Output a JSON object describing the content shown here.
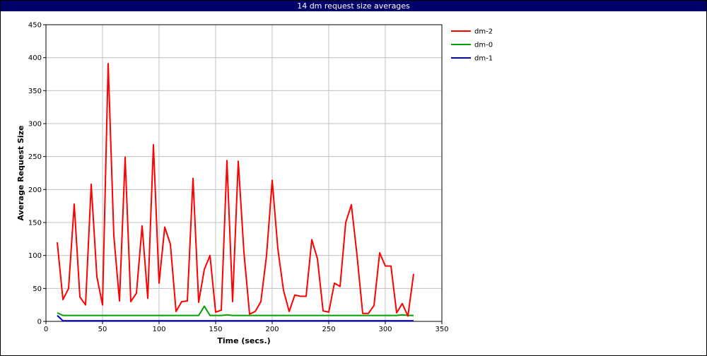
{
  "window": {
    "title": "14 dm request size averages"
  },
  "chart_data": {
    "type": "line",
    "title": "14 dm request size averages",
    "xlabel": "Time (secs.)",
    "ylabel": "Average Request Size",
    "xlim": [
      0,
      350
    ],
    "ylim": [
      0,
      450
    ],
    "xticks": [
      0,
      50,
      100,
      150,
      200,
      250,
      300,
      350
    ],
    "yticks": [
      0,
      50,
      100,
      150,
      200,
      250,
      300,
      350,
      400,
      450
    ],
    "grid": true,
    "legend_position": "right",
    "series": [
      {
        "name": "dm-2",
        "color": "#ff0000",
        "x": [
          10,
          15,
          20,
          25,
          30,
          35,
          40,
          45,
          50,
          55,
          60,
          65,
          70,
          75,
          80,
          85,
          90,
          95,
          100,
          105,
          110,
          115,
          120,
          125,
          130,
          135,
          140,
          145,
          150,
          155,
          160,
          165,
          170,
          175,
          180,
          185,
          190,
          195,
          200,
          205,
          210,
          215,
          220,
          225,
          230,
          235,
          240,
          245,
          250,
          255,
          260,
          265,
          270,
          275,
          280,
          285,
          290,
          295,
          300,
          305,
          310,
          315,
          320,
          325
        ],
        "y": [
          120,
          33,
          50,
          178,
          37,
          25,
          208,
          68,
          25,
          391,
          130,
          31,
          249,
          30,
          43,
          145,
          35,
          268,
          58,
          143,
          117,
          15,
          30,
          31,
          217,
          29,
          79,
          100,
          14,
          17,
          244,
          30,
          243,
          105,
          11,
          15,
          30,
          100,
          214,
          110,
          47,
          15,
          40,
          38,
          38,
          124,
          95,
          16,
          14,
          58,
          53,
          150,
          177,
          100,
          12,
          12,
          24,
          104,
          84,
          84,
          13,
          27,
          8,
          72
        ]
      },
      {
        "name": "dm-0",
        "color": "#00a000",
        "x": [
          10,
          15,
          20,
          25,
          30,
          35,
          40,
          45,
          50,
          55,
          60,
          65,
          70,
          75,
          80,
          85,
          90,
          95,
          100,
          105,
          110,
          115,
          120,
          125,
          130,
          135,
          140,
          145,
          150,
          155,
          160,
          165,
          170,
          175,
          180,
          185,
          190,
          195,
          200,
          205,
          210,
          215,
          220,
          225,
          230,
          235,
          240,
          245,
          250,
          255,
          260,
          265,
          270,
          275,
          280,
          285,
          290,
          295,
          300,
          305,
          310,
          315,
          320,
          325
        ],
        "y": [
          13,
          9,
          9,
          9,
          9,
          9,
          9,
          9,
          9,
          9,
          9,
          9,
          9,
          9,
          9,
          9,
          9,
          9,
          9,
          9,
          9,
          9,
          9,
          9,
          9,
          9,
          23,
          9,
          9,
          9,
          10,
          9,
          9,
          9,
          9,
          9,
          9,
          9,
          9,
          9,
          9,
          9,
          9,
          9,
          9,
          9,
          9,
          9,
          9,
          9,
          9,
          9,
          9,
          9,
          9,
          9,
          9,
          9,
          9,
          9,
          9,
          10,
          9,
          9
        ]
      },
      {
        "name": "dm-1",
        "color": "#0000cc",
        "x": [
          10,
          15,
          20,
          25,
          30,
          35,
          40,
          45,
          50,
          55,
          60,
          65,
          70,
          75,
          80,
          85,
          90,
          95,
          100,
          105,
          110,
          115,
          120,
          125,
          130,
          135,
          140,
          145,
          150,
          155,
          160,
          165,
          170,
          175,
          180,
          185,
          190,
          195,
          200,
          205,
          210,
          215,
          220,
          225,
          230,
          235,
          240,
          245,
          250,
          255,
          260,
          265,
          270,
          275,
          280,
          285,
          290,
          295,
          300,
          305,
          310,
          315,
          320,
          325
        ],
        "y": [
          9,
          1,
          1,
          1,
          1,
          1,
          1,
          1,
          1,
          1,
          1,
          1,
          1,
          1,
          1,
          1,
          1,
          1,
          1,
          1,
          1,
          1,
          1,
          1,
          1,
          1,
          1,
          1,
          1,
          1,
          1,
          1,
          1,
          1,
          1,
          1,
          1,
          1,
          1,
          1,
          1,
          1,
          1,
          1,
          1,
          1,
          1,
          1,
          1,
          1,
          1,
          1,
          1,
          1,
          1,
          1,
          1,
          1,
          1,
          1,
          1,
          1,
          1,
          1
        ]
      }
    ]
  }
}
